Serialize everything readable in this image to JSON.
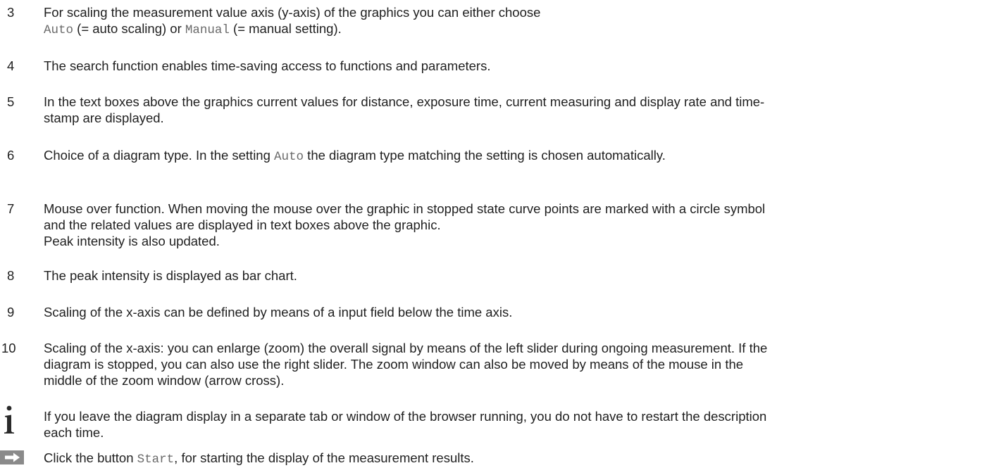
{
  "items": [
    {
      "num": "3",
      "lines": [
        [
          {
            "t": "For scaling the measurement value axis (y-axis) of the graphics you can either choose"
          }
        ],
        [
          {
            "t": "Auto",
            "code": true
          },
          {
            "t": " (= auto scaling) or "
          },
          {
            "t": "Manual",
            "code": true
          },
          {
            "t": " (= manual setting)."
          }
        ]
      ]
    },
    {
      "num": "4",
      "lines": [
        [
          {
            "t": "The search function enables time-saving access to functions and parameters."
          }
        ]
      ]
    },
    {
      "num": "5",
      "lines": [
        [
          {
            "t": "In the text boxes above the graphics current values for distance, exposure time, current measuring and display rate and time-"
          }
        ],
        [
          {
            "t": "stamp are displayed."
          }
        ]
      ]
    },
    {
      "num": "6",
      "lines": [
        [
          {
            "t": "Choice of a diagram type. In the setting "
          },
          {
            "t": "Auto",
            "code": true
          },
          {
            "t": " the diagram type matching the setting is chosen automatically."
          }
        ]
      ]
    },
    {
      "num": "7",
      "lines": [
        [
          {
            "t": "Mouse over function. When moving the mouse over the graphic in stopped state curve points are marked with a circle symbol"
          }
        ],
        [
          {
            "t": "and the related values are displayed in text boxes above the graphic."
          }
        ],
        [
          {
            "t": "Peak intensity is also updated."
          }
        ]
      ]
    },
    {
      "num": "8",
      "lines": [
        [
          {
            "t": "The peak intensity is displayed as bar chart."
          }
        ]
      ]
    },
    {
      "num": "9",
      "lines": [
        [
          {
            "t": "Scaling of the x-axis can be defined by means of a input field below the time axis."
          }
        ]
      ]
    },
    {
      "num": "10",
      "lines": [
        [
          {
            "t": "Scaling of the x-axis: you can enlarge (zoom) the overall signal by means of the left slider during ongoing measurement. If the"
          }
        ],
        [
          {
            "t": "diagram is stopped, you can also use the right slider. The zoom window can also be moved by means of the mouse in the"
          }
        ],
        [
          {
            "t": "middle of the zoom window (arrow cross)."
          }
        ]
      ]
    }
  ],
  "note": {
    "icon": "info-icon",
    "lines": [
      [
        {
          "t": "If you leave the diagram display in a separate tab or window of the browser running, you do not have to restart the description"
        }
      ],
      [
        {
          "t": "each time."
        }
      ]
    ]
  },
  "action": {
    "icon": "arrow-right-icon",
    "icon_color": "#8a8a8a",
    "lines": [
      [
        {
          "t": "Click the button "
        },
        {
          "t": "Start",
          "code": true
        },
        {
          "t": ", for starting the display of the measurement results."
        }
      ]
    ]
  }
}
